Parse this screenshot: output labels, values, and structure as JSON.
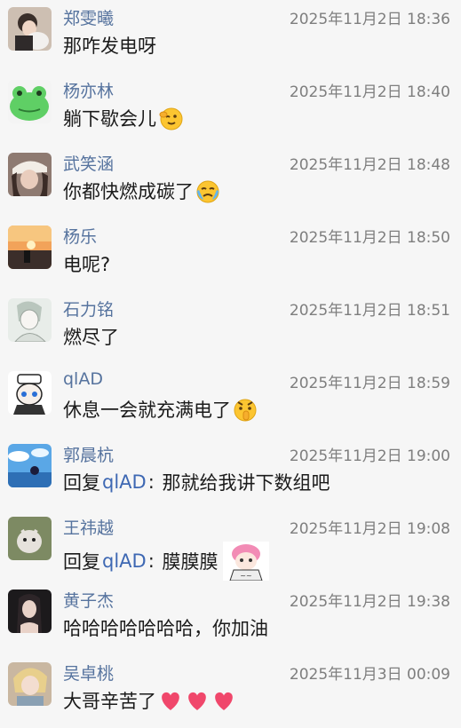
{
  "messages": [
    {
      "name": "郑雯曦",
      "time": "2025年11月2日 18:36",
      "text": "那咋发电呀"
    },
    {
      "name": "杨亦林",
      "time": "2025年11月2日 18:40",
      "text": "躺下歇会儿"
    },
    {
      "name": "武笑涵",
      "time": "2025年11月2日 18:48",
      "text": "你都快燃成碳了"
    },
    {
      "name": "杨乐",
      "time": "2025年11月2日 18:50",
      "text": "电呢?"
    },
    {
      "name": "石力铭",
      "time": "2025年11月2日 18:51",
      "text": "燃尽了"
    },
    {
      "name": "qlAD",
      "time": "2025年11月2日 18:59",
      "text": "休息一会就充满电了"
    },
    {
      "name": "郭晨杭",
      "time": "2025年11月2日 19:00",
      "reply_prefix": "回复",
      "reply_to": "qlAD",
      "reply_sep": ":",
      "text": " 那就给我讲下数组吧"
    },
    {
      "name": "王祎越",
      "time": "2025年11月2日 19:08",
      "reply_prefix": "回复",
      "reply_to": "qlAD",
      "reply_sep": ":",
      "text": " 膜膜膜"
    },
    {
      "name": "黄子杰",
      "time": "2025年11月2日 19:38",
      "text": "哈哈哈哈哈哈哈，你加油"
    },
    {
      "name": "吴卓桃",
      "time": "2025年11月3日 00:09",
      "text": "大哥辛苦了"
    }
  ],
  "colors": {
    "background": "#f6f6f6",
    "name": "#56739e",
    "time": "#7e7e7e",
    "text": "#1b1b1b",
    "reply_link": "#3e68b3",
    "heart": "#f0476b"
  },
  "emoji": {
    "m1": "salute-wink-emoji",
    "m2": "crying-emoji",
    "m5": "shushing-emoji",
    "m7": "anime-girl-sticker",
    "m9": [
      "heart-emoji",
      "heart-emoji",
      "heart-emoji"
    ]
  }
}
